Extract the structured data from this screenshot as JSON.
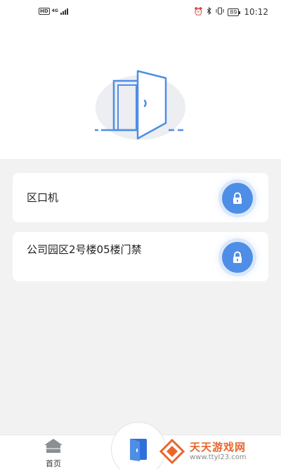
{
  "status_bar": {
    "hd": "HD",
    "network": "4G",
    "battery": "89",
    "time": "10:12",
    "icons": [
      "alarm-icon",
      "bluetooth-icon",
      "vibrate-icon"
    ]
  },
  "hero": {
    "icon": "open-door-illustration",
    "accent": "#4f8ee6"
  },
  "doors": [
    {
      "label": "区口机",
      "action_icon": "lock-icon"
    },
    {
      "label": "公司园区2号楼05楼门禁",
      "action_icon": "lock-icon"
    }
  ],
  "bottom_nav": {
    "home_label": "首页",
    "home_icon": "home-icon",
    "center_icon": "door-icon"
  },
  "watermark": {
    "title": "天天游戏网",
    "url": "www.ttyl23.com"
  },
  "colors": {
    "accent": "#4f8ee6",
    "background": "#f2f2f2",
    "watermark": "#e9662b"
  }
}
